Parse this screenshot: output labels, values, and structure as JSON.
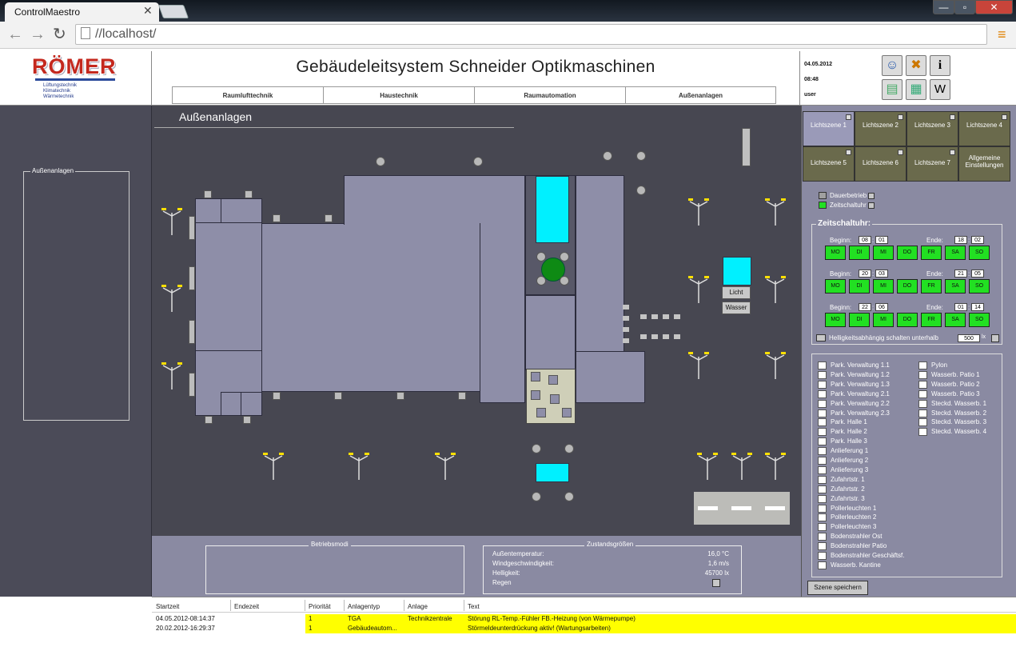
{
  "browser": {
    "tab_title": "ControlMaestro",
    "url": "//localhost/",
    "close_glyph": "✕",
    "win_min": "—",
    "win_max": "▫",
    "win_close": "✕"
  },
  "header": {
    "logo": {
      "name": "RÖMER",
      "lines": [
        "Lüftungstechnik",
        "Klimatechnik",
        "Wärmetechnik"
      ]
    },
    "title": "Gebäudeleitsystem Schneider Optikmaschinen",
    "nav_tabs": [
      "Raumlufttechnik",
      "Haustechnik",
      "Raumautomation",
      "Außenanlagen"
    ],
    "date": "04.05.2012",
    "time": "08:48",
    "user": "user",
    "buttons": {
      "info": "i",
      "w": "W"
    }
  },
  "sidebar": {
    "box_label": "Außenanlagen"
  },
  "main": {
    "title": "Außenanlagen",
    "light_label": "Licht",
    "water_label": "Wasser"
  },
  "betriebsmodi": {
    "label": "Betriebsmodi"
  },
  "zustand": {
    "label": "Zustandsgrößen",
    "rows": [
      {
        "label": "Außentemperatur:",
        "value": "16,0 °C"
      },
      {
        "label": "Windgeschwindigkeit:",
        "value": "1,6 m/s"
      },
      {
        "label": "Helligkeit:",
        "value": "45700 lx"
      },
      {
        "label": "Regen",
        "value": ""
      }
    ]
  },
  "right": {
    "tabs": [
      "Lichtszene 1",
      "Lichtszene 2",
      "Lichtszene 3",
      "Lichtszene 4",
      "Lichtszene 5",
      "Lichtszene 6",
      "Lichtszene 7",
      "Allgemeine Einstellungen"
    ],
    "modes": [
      {
        "label": "Dauerbetrieb",
        "color": "#a0a0a0"
      },
      {
        "label": "Zeitschaltuhr",
        "color": "#22e022"
      }
    ],
    "zeitschaltuhr": {
      "label": "Zeitschaltuhr:",
      "begin_label": "Beginn:",
      "end_label": "Ende:",
      "slots": [
        {
          "begin_h": "08",
          "begin_m": "01",
          "end_h": "18",
          "end_m": "02"
        },
        {
          "begin_h": "20",
          "begin_m": "03",
          "end_h": "21",
          "end_m": "05"
        },
        {
          "begin_h": "22",
          "begin_m": "06",
          "end_h": "01",
          "end_m": "14"
        }
      ],
      "days": [
        "MO",
        "DI",
        "MI",
        "DO",
        "FR",
        "SA",
        "SO"
      ],
      "hell_label": "Helligkeitsabhängig schalten unterhalb",
      "hell_value": "500",
      "hell_unit": "lx"
    },
    "list_col1": [
      "Park. Verwaltung 1.1",
      "Park. Verwaltung 1.2",
      "Park. Verwaltung 1.3",
      "Park. Verwaltung 2.1",
      "Park. Verwaltung 2.2",
      "Park. Verwaltung 2.3",
      "Park. Halle 1",
      "Park. Halle 2",
      "Park. Halle 3",
      "Anlieferung 1",
      "Anlieferung 2",
      "Anlieferung 3",
      "Zufahrtstr. 1",
      "Zufahrtstr. 2",
      "Zufahrtstr. 3",
      "Pollerleuchten 1",
      "Pollerleuchten 2",
      "Pollerleuchten 3",
      "Bodenstrahler Ost",
      "Bodenstrahler Patio",
      "Bodenstrahler Geschäftsf.",
      "Wasserb. Kantine"
    ],
    "list_col2": [
      "Pylon",
      "Wasserb. Patio 1",
      "Wasserb. Patio 2",
      "Wasserb. Patio 3",
      "Steckd. Wasserb. 1",
      "Steckd. Wasserb. 2",
      "Steckd. Wasserb. 3",
      "Steckd. Wasserb. 4"
    ],
    "save_label": "Szene speichern"
  },
  "alarms": {
    "headers": [
      "Startzeit",
      "Endezeit",
      "Priorität",
      "Anlagentyp",
      "Anlage",
      "Text"
    ],
    "rows": [
      {
        "start": "04.05.2012-08:14:37",
        "end": "",
        "prio": "1",
        "type": "TGA",
        "anlage": "Technikzentrale",
        "text": "Störung RL-Temp.-Fühler FB.-Heizung (von Wärmepumpe)"
      },
      {
        "start": "20.02.2012-16:29:37",
        "end": "",
        "prio": "1",
        "type": "Gebäudeautom...",
        "anlage": "",
        "text": "Störmeldeunterdrückung aktiv! (Wartungsarbeiten)"
      }
    ]
  }
}
